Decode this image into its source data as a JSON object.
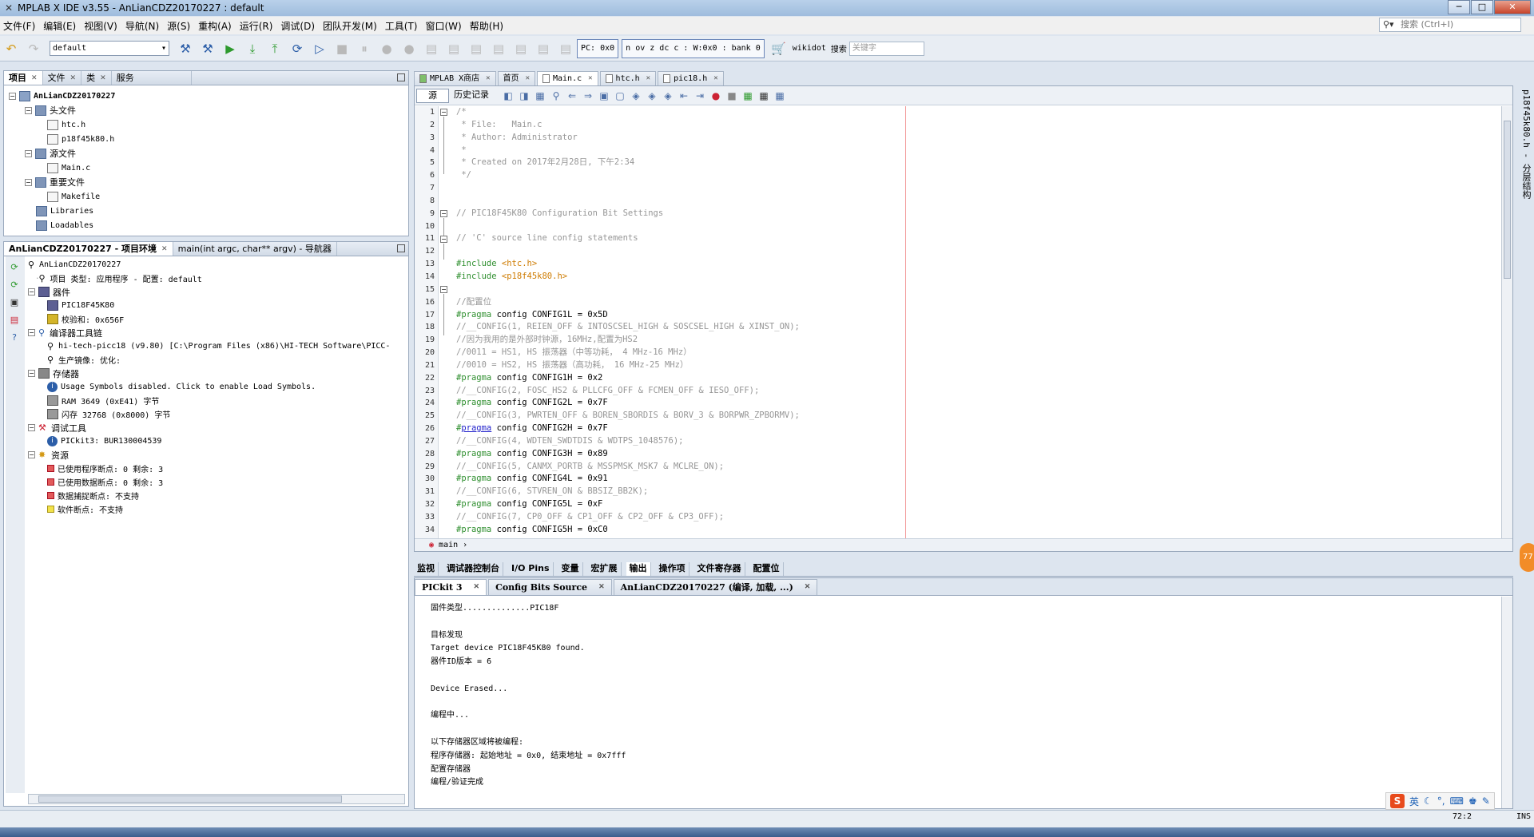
{
  "window": {
    "title": "MPLAB X IDE v3.55 - AnLianCDZ20170227 : default"
  },
  "menu": [
    "文件(F)",
    "编辑(E)",
    "视图(V)",
    "导航(N)",
    "源(S)",
    "重构(A)",
    "运行(R)",
    "调试(D)",
    "团队开发(M)",
    "工具(T)",
    "窗口(W)",
    "帮助(H)"
  ],
  "search": {
    "placeholder": "搜索 (Ctrl+I)"
  },
  "toolbar": {
    "config": "default",
    "pc": "PC: 0x0",
    "status": "n ov z dc c  : W:0x0 : bank 0",
    "wiki_label": "wikidot",
    "search_label": "搜索",
    "wiki_placeholder": "关键字"
  },
  "projects_panel": {
    "tabs": [
      "项目",
      "文件",
      "类",
      "服务"
    ],
    "tree": {
      "root": "AnLianCDZ20170227",
      "headers": "头文件",
      "header_files": [
        "htc.h",
        "p18f45k80.h"
      ],
      "sources": "源文件",
      "source_files": [
        "Main.c"
      ],
      "important": "重要文件",
      "important_files": [
        "Makefile"
      ],
      "libraries": "Libraries",
      "loadables": "Loadables"
    }
  },
  "env_panel": {
    "tabs": [
      "AnLianCDZ20170227 - 项目环境",
      "main(int argc, char** argv) - 导航器"
    ],
    "root": "AnLianCDZ20170227",
    "project_type": "项目 类型: 应用程序 - 配置: default",
    "device_label": "器件",
    "device": "PIC18F45K80",
    "checksum": "校验和: 0x656F",
    "toolchain_label": "编译器工具链",
    "compiler": "hi-tech-picc18 (v9.80) [C:\\Program Files (x86)\\HI-TECH Software\\PICC-",
    "image": "生产镜像: 优化:",
    "memory_label": "存储器",
    "usage": "Usage Symbols disabled. Click to enable Load Symbols.",
    "ram": "RAM 3649 (0xE41) 字节",
    "flash": "闪存 32768 (0x8000) 字节",
    "debug_label": "调试工具",
    "pickit": "PICkit3: BUR130004539",
    "resources_label": "资源",
    "res1": "已使用程序断点: 0  剩余: 3",
    "res2": "已使用数据断点: 0  剩余: 3",
    "res3": "数据捕捉断点: 不支持",
    "res4": "软件断点: 不支持"
  },
  "editor_tabs": [
    "MPLAB X商店",
    "首页",
    "Main.c",
    "htc.h",
    "pic18.h"
  ],
  "editor_toolbar": {
    "source": "源",
    "history": "历史记录"
  },
  "line_numbers": [
    "1",
    "2",
    "3",
    "4",
    "5",
    "6",
    "7",
    "8",
    "9",
    "10",
    "11",
    "12",
    "13",
    "14",
    "15",
    "16",
    "17",
    "18",
    "19",
    "20",
    "21",
    "22",
    "23",
    "24",
    "25",
    "26",
    "27",
    "28",
    "29",
    "30",
    "31",
    "32",
    "33",
    "34"
  ],
  "code": {
    "l1": "/*",
    "l2": " * File:   Main.c",
    "l3": " * Author: Administrator",
    "l4": " *",
    "l5": " * Created on 2017年2月28日, 下午2:34",
    "l6": " */",
    "l7": "",
    "l8": "",
    "l9": "// PIC18F45K80 Configuration Bit Settings",
    "l10": "",
    "l11": "// 'C' source line config statements",
    "l12": "",
    "l13a": "#include ",
    "l13b": "<htc.h>",
    "l14a": "#include ",
    "l14b": "<p18f45k80.h>",
    "l15": "",
    "l16": "//配置位",
    "l17a": "#pragma",
    "l17b": " config CONFIG1L = 0x5D",
    "l18": "//__CONFIG(1, REIEN_OFF & INTOSCSEL_HIGH & SOSCSEL_HIGH & XINST_ON);",
    "l19": "//因为我用的是外部时钟源，16MHz,配置为HS2",
    "l20": "//0011 = HS1, HS 振荡器（中等功耗， 4 MHz-16 MHz）",
    "l21": "//0010 = HS2, HS 振荡器（高功耗， 16 MHz-25 MHz）",
    "l22a": "#pragma",
    "l22b": " config CONFIG1H = 0x2",
    "l23": "//__CONFIG(2, FOSC_HS2 & PLLCFG_OFF & FCMEN_OFF & IESO_OFF);",
    "l24a": "#pragma",
    "l24b": " config CONFIG2L = 0x7F",
    "l25": "//__CONFIG(3, PWRTEN_OFF & BOREN_SBORDIS & BORV_3 & BORPWR_ZPBORMV);",
    "l26a": "#",
    "l26b": "pragma",
    "l26c": " config CONFIG2H = 0x7F",
    "l27": "//__CONFIG(4, WDTEN_SWDTDIS & WDTPS_1048576);",
    "l28a": "#pragma",
    "l28b": " config CONFIG3H = 0x89",
    "l29": "//__CONFIG(5, CANMX_PORTB & MSSPMSK_MSK7 & MCLRE_ON);",
    "l30a": "#pragma",
    "l30b": " config CONFIG4L = 0x91",
    "l31": "//__CONFIG(6, STVREN_ON & BBSIZ_BB2K);",
    "l32a": "#pragma",
    "l32b": " config CONFIG5L = 0xF",
    "l33": "//__CONFIG(7, CP0_OFF & CP1_OFF & CP2_OFF & CP3_OFF);",
    "l34a": "#pragma",
    "l34b": " config CONFIG5H = 0xC0"
  },
  "breadcrumb": "main",
  "bottom_tabs": [
    "监视",
    "调试器控制台",
    "I/O Pins",
    "变量",
    "宏扩展",
    "输出",
    "操作项",
    "文件寄存器",
    "配置位"
  ],
  "output_tabs": [
    "PICkit 3",
    "Config Bits Source",
    "AnLianCDZ20170227 (编译, 加载, ...)"
  ],
  "output_lines": [
    "固件类型..............PIC18F",
    "",
    "目标发现",
    "Target device PIC18F45K80 found.",
    "器件ID版本 = 6",
    "",
    "Device Erased...",
    "",
    "编程中...",
    "",
    "以下存储器区域将被编程:",
    "程序存储器: 起始地址 = 0x0, 结束地址 = 0x7fff",
    "配置存储器",
    "编程/验证完成"
  ],
  "right_strip": "p18f45k80.h - 分层结构",
  "status": {
    "position": "72:2",
    "mode": "INS",
    "ime": "英"
  }
}
